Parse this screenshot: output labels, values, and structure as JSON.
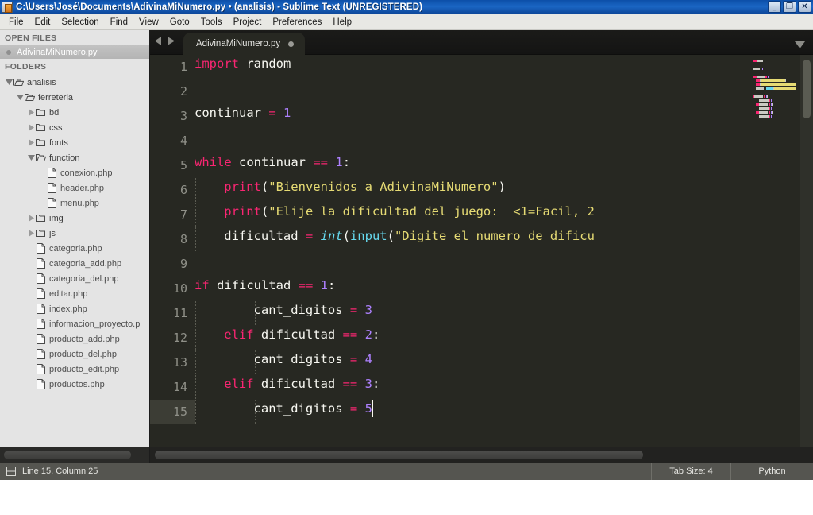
{
  "window": {
    "title": "C:\\Users\\José\\Documents\\AdivinaMiNumero.py • (analisis) - Sublime Text (UNREGISTERED)",
    "app_icon": "sublime-text-icon",
    "controls": {
      "minimize": "_",
      "restore": "❐",
      "close": "✕"
    }
  },
  "menubar": {
    "items": [
      {
        "label": "File"
      },
      {
        "label": "Edit"
      },
      {
        "label": "Selection"
      },
      {
        "label": "Find"
      },
      {
        "label": "View"
      },
      {
        "label": "Goto"
      },
      {
        "label": "Tools"
      },
      {
        "label": "Project"
      },
      {
        "label": "Preferences"
      },
      {
        "label": "Help"
      }
    ]
  },
  "sidebar": {
    "open_files_header": "OPEN FILES",
    "open_files": [
      {
        "label": "AdivinaMiNumero.py",
        "dirty": true
      }
    ],
    "folders_header": "FOLDERS",
    "tree": [
      {
        "label": "analisis",
        "type": "folder",
        "depth": 0,
        "expanded": true
      },
      {
        "label": "ferreteria",
        "type": "folder",
        "depth": 1,
        "expanded": true
      },
      {
        "label": "bd",
        "type": "folder",
        "depth": 2,
        "expanded": false
      },
      {
        "label": "css",
        "type": "folder",
        "depth": 2,
        "expanded": false
      },
      {
        "label": "fonts",
        "type": "folder",
        "depth": 2,
        "expanded": false
      },
      {
        "label": "function",
        "type": "folder",
        "depth": 2,
        "expanded": true
      },
      {
        "label": "conexion.php",
        "type": "file",
        "depth": 3
      },
      {
        "label": "header.php",
        "type": "file",
        "depth": 3
      },
      {
        "label": "menu.php",
        "type": "file",
        "depth": 3
      },
      {
        "label": "img",
        "type": "folder",
        "depth": 2,
        "expanded": false
      },
      {
        "label": "js",
        "type": "folder",
        "depth": 2,
        "expanded": false
      },
      {
        "label": "categoria.php",
        "type": "file",
        "depth": 2
      },
      {
        "label": "categoria_add.php",
        "type": "file",
        "depth": 2
      },
      {
        "label": "categoria_del.php",
        "type": "file",
        "depth": 2
      },
      {
        "label": "editar.php",
        "type": "file",
        "depth": 2
      },
      {
        "label": "index.php",
        "type": "file",
        "depth": 2
      },
      {
        "label": "informacion_proyecto.p",
        "type": "file",
        "depth": 2
      },
      {
        "label": "producto_add.php",
        "type": "file",
        "depth": 2
      },
      {
        "label": "producto_del.php",
        "type": "file",
        "depth": 2
      },
      {
        "label": "producto_edit.php",
        "type": "file",
        "depth": 2
      },
      {
        "label": "productos.php",
        "type": "file",
        "depth": 2
      }
    ]
  },
  "tabbar": {
    "back_icon": "triangle-left-icon",
    "forward_icon": "triangle-right-icon",
    "menu_icon": "chevron-down-icon",
    "tabs": [
      {
        "label": "AdivinaMiNumero.py",
        "dirty": true,
        "active": true
      }
    ]
  },
  "editor": {
    "language": "Python",
    "active_line": 15,
    "cursor": {
      "line": 15,
      "column": 25
    },
    "line_numbers": [
      1,
      2,
      3,
      4,
      5,
      6,
      7,
      8,
      9,
      10,
      11,
      12,
      13,
      14,
      15
    ],
    "lines": [
      {
        "n": 1,
        "indent": 0,
        "tokens": [
          {
            "t": "import",
            "c": "kw"
          },
          {
            "t": " random",
            "c": "pl"
          }
        ]
      },
      {
        "n": 2,
        "indent": 0,
        "tokens": []
      },
      {
        "n": 3,
        "indent": 0,
        "tokens": [
          {
            "t": "continuar ",
            "c": "pl"
          },
          {
            "t": "=",
            "c": "op"
          },
          {
            "t": " ",
            "c": "pl"
          },
          {
            "t": "1",
            "c": "num"
          }
        ]
      },
      {
        "n": 4,
        "indent": 0,
        "tokens": []
      },
      {
        "n": 5,
        "indent": 0,
        "tokens": [
          {
            "t": "while",
            "c": "kw"
          },
          {
            "t": " continuar ",
            "c": "pl"
          },
          {
            "t": "==",
            "c": "op"
          },
          {
            "t": " ",
            "c": "pl"
          },
          {
            "t": "1",
            "c": "num"
          },
          {
            "t": ":",
            "c": "pl"
          }
        ]
      },
      {
        "n": 6,
        "indent": 1,
        "tokens": [
          {
            "t": "print",
            "c": "kw"
          },
          {
            "t": "(",
            "c": "pl"
          },
          {
            "t": "\"Bienvenidos a AdivinaMiNumero\"",
            "c": "str"
          },
          {
            "t": ")",
            "c": "pl"
          }
        ]
      },
      {
        "n": 7,
        "indent": 1,
        "tokens": [
          {
            "t": "print",
            "c": "kw"
          },
          {
            "t": "(",
            "c": "pl"
          },
          {
            "t": "\"Elije la dificultad del juego:  <1=Facil, 2",
            "c": "str"
          }
        ]
      },
      {
        "n": 8,
        "indent": 1,
        "tokens": [
          {
            "t": "dificultad ",
            "c": "pl"
          },
          {
            "t": "=",
            "c": "op"
          },
          {
            "t": " ",
            "c": "pl"
          },
          {
            "t": "int",
            "c": "fn"
          },
          {
            "t": "(",
            "c": "pl"
          },
          {
            "t": "input",
            "c": "builtin"
          },
          {
            "t": "(",
            "c": "pl"
          },
          {
            "t": "\"Digite el numero de dificu",
            "c": "str"
          }
        ]
      },
      {
        "n": 9,
        "indent": 0,
        "tokens": []
      },
      {
        "n": 10,
        "indent": 0,
        "tokens": [
          {
            "t": "if",
            "c": "kw"
          },
          {
            "t": " dificultad ",
            "c": "pl"
          },
          {
            "t": "==",
            "c": "op"
          },
          {
            "t": " ",
            "c": "pl"
          },
          {
            "t": "1",
            "c": "num"
          },
          {
            "t": ":",
            "c": "pl"
          }
        ]
      },
      {
        "n": 11,
        "indent": 2,
        "tokens": [
          {
            "t": "cant_digitos ",
            "c": "pl"
          },
          {
            "t": "=",
            "c": "op"
          },
          {
            "t": " ",
            "c": "pl"
          },
          {
            "t": "3",
            "c": "num"
          }
        ]
      },
      {
        "n": 12,
        "indent": 1,
        "tokens": [
          {
            "t": "elif",
            "c": "kw"
          },
          {
            "t": " dificultad ",
            "c": "pl"
          },
          {
            "t": "==",
            "c": "op"
          },
          {
            "t": " ",
            "c": "pl"
          },
          {
            "t": "2",
            "c": "num"
          },
          {
            "t": ":",
            "c": "pl"
          }
        ]
      },
      {
        "n": 13,
        "indent": 2,
        "tokens": [
          {
            "t": "cant_digitos ",
            "c": "pl"
          },
          {
            "t": "=",
            "c": "op"
          },
          {
            "t": " ",
            "c": "pl"
          },
          {
            "t": "4",
            "c": "num"
          }
        ]
      },
      {
        "n": 14,
        "indent": 1,
        "tokens": [
          {
            "t": "elif",
            "c": "kw"
          },
          {
            "t": " dificultad ",
            "c": "pl"
          },
          {
            "t": "==",
            "c": "op"
          },
          {
            "t": " ",
            "c": "pl"
          },
          {
            "t": "3",
            "c": "num"
          },
          {
            "t": ":",
            "c": "pl"
          }
        ]
      },
      {
        "n": 15,
        "indent": 2,
        "tokens": [
          {
            "t": "cant_digitos ",
            "c": "pl"
          },
          {
            "t": "=",
            "c": "op"
          },
          {
            "t": " ",
            "c": "pl"
          },
          {
            "t": "5",
            "c": "num"
          }
        ]
      }
    ]
  },
  "statusbar": {
    "panel_icon": "layout-panel-icon",
    "cursor_text": "Line 15, Column 25",
    "tab_size": "Tab Size: 4",
    "syntax": "Python"
  },
  "colors": {
    "editor_bg": "#272822",
    "sidebar_bg": "#e4e4e4",
    "titlebar_blue": "#1b66c4",
    "keyword": "#f92672",
    "string": "#e6db74",
    "number": "#ae81ff",
    "function": "#66d9ef",
    "plain": "#f8f8f2",
    "gutter_text": "#8f9088",
    "active_line": "#3c3d35",
    "statusbar_bg": "#555550"
  }
}
